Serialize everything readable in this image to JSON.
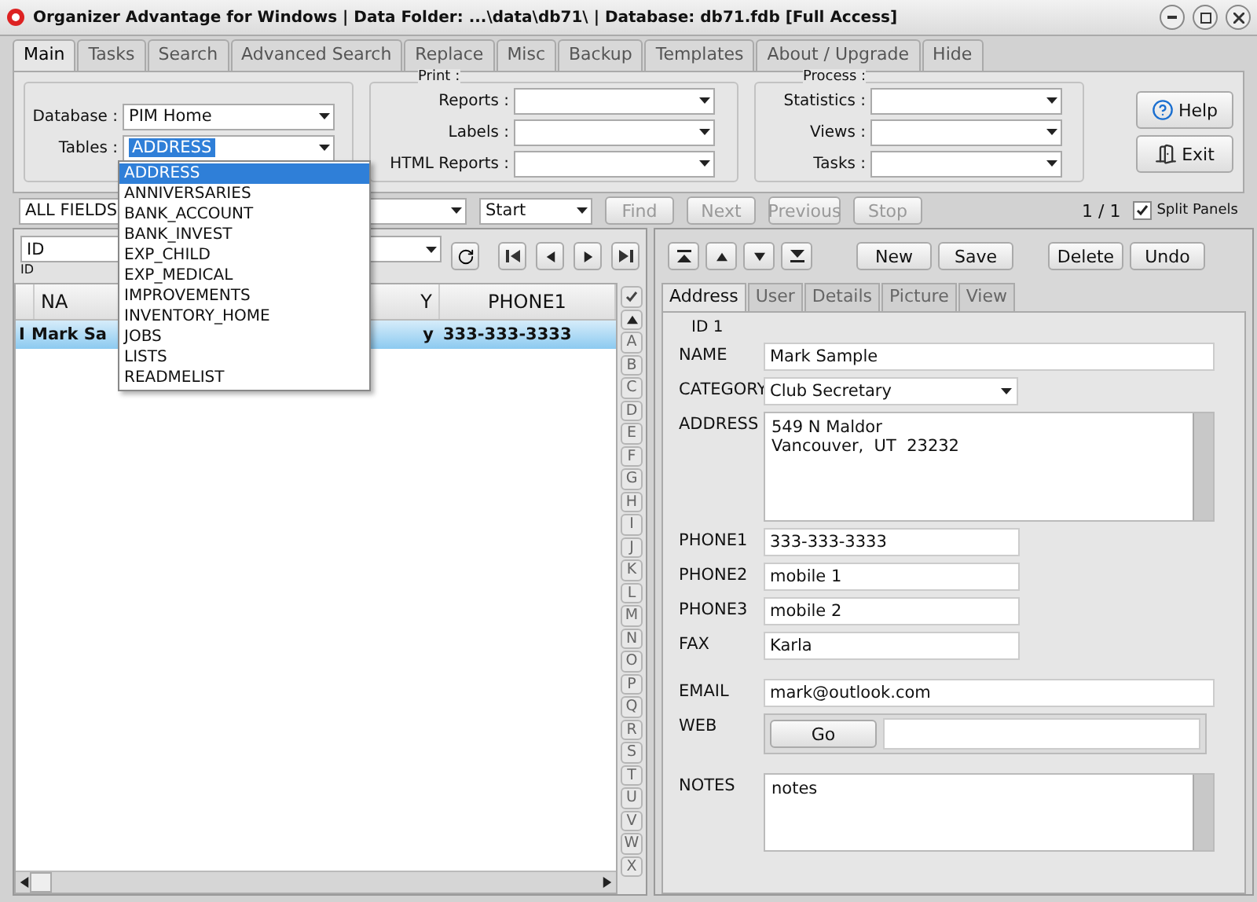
{
  "window": {
    "title": "Organizer Advantage for Windows | Data Folder: ...\\data\\db71\\ | Database: db71.fdb [Full Access]"
  },
  "tabs": [
    {
      "label": "Main",
      "selected": true
    },
    {
      "label": "Tasks",
      "selected": false
    },
    {
      "label": "Search",
      "selected": false
    },
    {
      "label": "Advanced Search",
      "selected": false
    },
    {
      "label": "Replace",
      "selected": false
    },
    {
      "label": "Misc",
      "selected": false
    },
    {
      "label": "Backup",
      "selected": false
    },
    {
      "label": "Templates",
      "selected": false
    },
    {
      "label": "About / Upgrade",
      "selected": false
    },
    {
      "label": "Hide",
      "selected": false
    }
  ],
  "main_panel": {
    "database": {
      "label": "Database :",
      "value": "PIM Home"
    },
    "tables": {
      "label": "Tables :",
      "value": "ADDRESS"
    },
    "print": {
      "title": "Print :",
      "fields": [
        {
          "label": "Reports :"
        },
        {
          "label": "Labels :"
        },
        {
          "label": "HTML Reports :"
        }
      ]
    },
    "process": {
      "title": "Process :",
      "fields": [
        {
          "label": "Statistics :"
        },
        {
          "label": "Views :"
        },
        {
          "label": "Tasks :"
        }
      ]
    },
    "buttons": [
      {
        "label": "Help",
        "kind": "help"
      },
      {
        "label": "Exit",
        "kind": "exit"
      }
    ]
  },
  "table_dropdown": {
    "items": [
      {
        "label": "ADDRESS",
        "selected": true
      },
      {
        "label": "ANNIVERSARIES",
        "selected": false
      },
      {
        "label": "BANK_ACCOUNT",
        "selected": false
      },
      {
        "label": "BANK_INVEST",
        "selected": false
      },
      {
        "label": "EXP_CHILD",
        "selected": false
      },
      {
        "label": "EXP_MEDICAL",
        "selected": false
      },
      {
        "label": "IMPROVEMENTS",
        "selected": false
      },
      {
        "label": "INVENTORY_HOME",
        "selected": false
      },
      {
        "label": "JOBS",
        "selected": false
      },
      {
        "label": "LISTS",
        "selected": false
      },
      {
        "label": "READMELIST",
        "selected": false
      }
    ]
  },
  "search_bar": {
    "field": "ALL FIELDS",
    "mode": "Start",
    "buttons": [
      {
        "label": "Find",
        "disabled": true
      },
      {
        "label": "Next",
        "disabled": true
      },
      {
        "label": "Previous",
        "disabled": true
      },
      {
        "label": "Stop",
        "disabled": true
      }
    ],
    "record_count": "1 / 1",
    "split_panels": {
      "label": "Split Panels",
      "checked": true
    }
  },
  "list_pane": {
    "sort_field": "ID",
    "sort_hint": "ID",
    "columns": [
      "NA",
      "Y",
      "PHONE1"
    ],
    "rows": [
      {
        "marker": "I",
        "cells": [
          "Mark Sa",
          "y",
          "333-333-3333"
        ],
        "selected": true
      }
    ],
    "alphabet": [
      "A",
      "B",
      "C",
      "D",
      "E",
      "F",
      "G",
      "H",
      "I",
      "J",
      "K",
      "L",
      "M",
      "N",
      "O",
      "P",
      "Q",
      "R",
      "S",
      "T",
      "U",
      "V",
      "W",
      "X"
    ]
  },
  "record_pane": {
    "buttons": [
      "New",
      "Save",
      "Delete",
      "Undo"
    ],
    "tabs": [
      {
        "label": "Address",
        "selected": true
      },
      {
        "label": "User",
        "selected": false
      },
      {
        "label": "Details",
        "selected": false
      },
      {
        "label": "Picture",
        "selected": false
      },
      {
        "label": "View",
        "selected": false
      }
    ],
    "id_label": "ID 1",
    "fields": [
      {
        "kind": "text",
        "label": "NAME",
        "value": "Mark Sample"
      },
      {
        "kind": "select",
        "label": "CATEGORY",
        "value": "Club Secretary"
      },
      {
        "kind": "memo",
        "label": "ADDRESS",
        "value": "549 N Maldor\nVancouver,  UT  23232"
      },
      {
        "kind": "short",
        "label": "PHONE1",
        "value": "333-333-3333"
      },
      {
        "kind": "short",
        "label": "PHONE2",
        "value": "mobile 1"
      },
      {
        "kind": "short",
        "label": "PHONE3",
        "value": "mobile 2"
      },
      {
        "kind": "short",
        "label": "FAX",
        "value": "Karla"
      },
      {
        "kind": "text",
        "label": "EMAIL",
        "value": "mark@outlook.com"
      },
      {
        "kind": "web",
        "label": "WEB",
        "button": "Go"
      },
      {
        "kind": "notes",
        "label": "NOTES",
        "value": "notes"
      }
    ]
  }
}
